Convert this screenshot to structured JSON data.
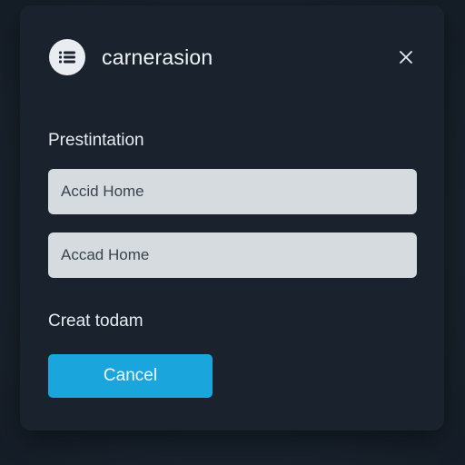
{
  "dialog": {
    "title": "carnerasion",
    "header_icon": "list-icon",
    "close_icon": "close-icon",
    "section_label": "Prestintation",
    "fields": [
      {
        "value": "Accid Home",
        "placeholder": ""
      },
      {
        "value": "Accad Home",
        "placeholder": ""
      }
    ],
    "secondary_label": "Creat todam",
    "primary_button_label": "Cancel"
  },
  "colors": {
    "background": "#1b2430",
    "dialog": "#19222d",
    "field": "#d6dbe0",
    "accent": "#1aa6dc",
    "text": "#e8ecf0"
  }
}
